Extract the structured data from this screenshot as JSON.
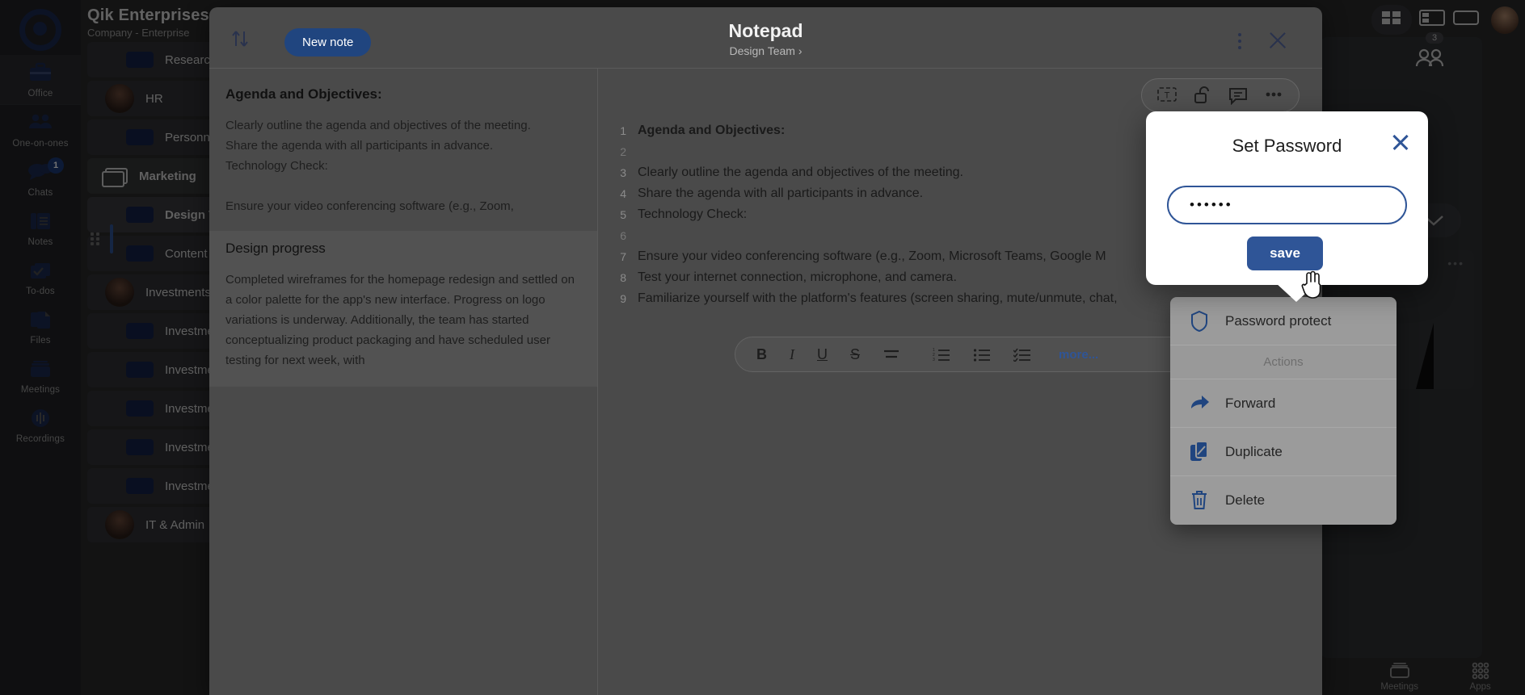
{
  "background": {
    "header": {
      "title": "Qik Enterprises Private Limited",
      "subtitle": "Company - Enterprise"
    },
    "rail": {
      "logo_name": "qik-logo",
      "items": [
        {
          "label": "Office",
          "icon": "briefcase-icon",
          "active": true,
          "badge": ""
        },
        {
          "label": "One-on-ones",
          "icon": "people-icon",
          "active": false,
          "badge": ""
        },
        {
          "label": "Chats",
          "icon": "chat-bubbles-icon",
          "active": false,
          "badge": "1"
        },
        {
          "label": "Notes",
          "icon": "notes-icon",
          "active": false,
          "badge": ""
        },
        {
          "label": "To-dos",
          "icon": "todos-icon",
          "active": false,
          "badge": ""
        },
        {
          "label": "Files",
          "icon": "files-icon",
          "active": false,
          "badge": ""
        },
        {
          "label": "Meetings",
          "icon": "meetings-icon",
          "active": false,
          "badge": ""
        },
        {
          "label": "Recordings",
          "icon": "recordings-icon",
          "active": false,
          "badge": ""
        }
      ]
    },
    "list": [
      {
        "type": "item",
        "label": "Research"
      },
      {
        "type": "person",
        "label": "HR"
      },
      {
        "type": "item",
        "label": "Personnel"
      },
      {
        "type": "group",
        "label": "Marketing"
      },
      {
        "type": "selected",
        "label": "Design Team"
      },
      {
        "type": "item",
        "label": "Content"
      },
      {
        "type": "person",
        "label": "Investments"
      },
      {
        "type": "item",
        "label": "Investment A"
      },
      {
        "type": "item",
        "label": "Investment B"
      },
      {
        "type": "item",
        "label": "Investment C"
      },
      {
        "type": "item",
        "label": "Investment D"
      },
      {
        "type": "item",
        "label": "Investment E"
      },
      {
        "type": "person",
        "label": "IT & Admin"
      }
    ],
    "panel": {
      "members_badge": "3"
    },
    "bottom_nav": [
      {
        "label": "Meetings",
        "icon": "meetings-icon"
      },
      {
        "label": "Apps",
        "icon": "apps-grid-icon"
      }
    ]
  },
  "modal": {
    "title": "Notepad",
    "breadcrumb": "Design Team ›",
    "new_note_label": "New note",
    "sort_icon": "sort-arrows-icon",
    "kebab_icon": "more-vertical-icon",
    "close_icon": "close-icon"
  },
  "note_list": [
    {
      "title": "Agenda and Objectives:",
      "body": "Clearly outline the agenda and objectives of the meeting.\nShare the agenda with all participants in advance.\nTechnology Check:\n\nEnsure your video conferencing software (e.g., Zoom,",
      "selected": false
    },
    {
      "title": "Design progress",
      "body": "Completed wireframes for the homepage redesign and settled on a color palette for the app's new interface. Progress on logo variations is underway. Additionally, the team has started conceptualizing product packaging and have scheduled user testing for next week, with",
      "selected": true
    }
  ],
  "editor": {
    "tools": [
      {
        "icon": "text-box-icon"
      },
      {
        "icon": "unlock-icon"
      },
      {
        "icon": "comment-icon"
      },
      {
        "icon": "more-horizontal-icon"
      }
    ],
    "lines": [
      {
        "n": "1",
        "text": "Agenda and Objectives:",
        "bold": true
      },
      {
        "n": "2",
        "text": "",
        "bold": false
      },
      {
        "n": "3",
        "text": "Clearly outline the agenda and objectives of the meeting.",
        "bold": false
      },
      {
        "n": "4",
        "text": "Share the agenda with all participants in advance.",
        "bold": false
      },
      {
        "n": "5",
        "text": "Technology Check:",
        "bold": false
      },
      {
        "n": "6",
        "text": "",
        "bold": false
      },
      {
        "n": "7",
        "text": "Ensure your video conferencing software (e.g., Zoom, Microsoft Teams, Google M",
        "bold": false
      },
      {
        "n": "8",
        "text": "Test your internet connection, microphone, and camera.",
        "bold": false
      },
      {
        "n": "9",
        "text": "Familiarize yourself with the platform's features (screen sharing, mute/unmute, chat,",
        "bold": false
      }
    ],
    "format_bar": {
      "bold": "B",
      "italic": "I",
      "underline": "U",
      "strike": "S",
      "align_icon": "align-icon",
      "ordered_list_icon": "ordered-list-icon",
      "bullet_list_icon": "bullet-list-icon",
      "checklist_icon": "checklist-icon",
      "more_label": "more..."
    }
  },
  "context_menu": {
    "items": [
      {
        "label": "Password protect",
        "icon": "shield-icon",
        "kind": "item"
      },
      {
        "label": "Actions",
        "icon": "",
        "kind": "section"
      },
      {
        "label": "Forward",
        "icon": "forward-arrow-icon",
        "kind": "item"
      },
      {
        "label": "Duplicate",
        "icon": "duplicate-icon",
        "kind": "item"
      },
      {
        "label": "Delete",
        "icon": "trash-icon",
        "kind": "item"
      }
    ]
  },
  "password_dialog": {
    "title": "Set Password",
    "close_icon": "close-icon",
    "input_value": "••••••",
    "input_placeholder": "",
    "save_label": "save"
  },
  "colors": {
    "accent_blue": "#2f5597",
    "dark_navy": "#1b2a52",
    "button_blue": "#20457f",
    "menu_gray": "#9b9b9b",
    "dialog_white": "#ffffff"
  }
}
